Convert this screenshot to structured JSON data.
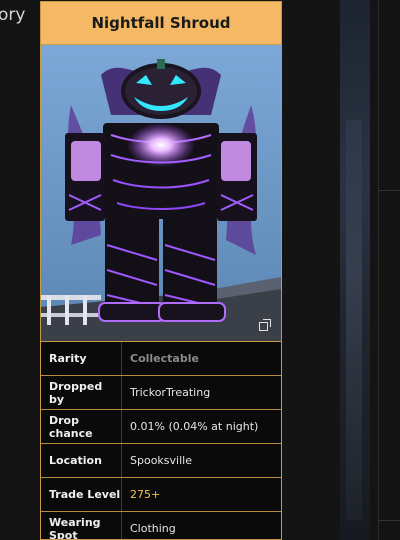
{
  "background": {
    "left_text": "ory"
  },
  "item": {
    "name": "Nightfall Shroud",
    "image_icon": "pumpkin-avatar-image",
    "expand_icon": "expand-icon",
    "colors": {
      "header": "#f5b965",
      "border": "#c79a45",
      "trade_level": "#f2c14a"
    }
  },
  "info_rows": [
    {
      "label": "Rarity",
      "value": "Collectable"
    },
    {
      "label": "Dropped by",
      "value": "TrickorTreating"
    },
    {
      "label": "Drop chance",
      "value": "0.01% (0.04% at night)"
    },
    {
      "label": "Location",
      "value": "Spooksville"
    },
    {
      "label": "Trade Level",
      "value": "275+"
    },
    {
      "label": "Wearing Spot",
      "value": "Clothing"
    }
  ]
}
